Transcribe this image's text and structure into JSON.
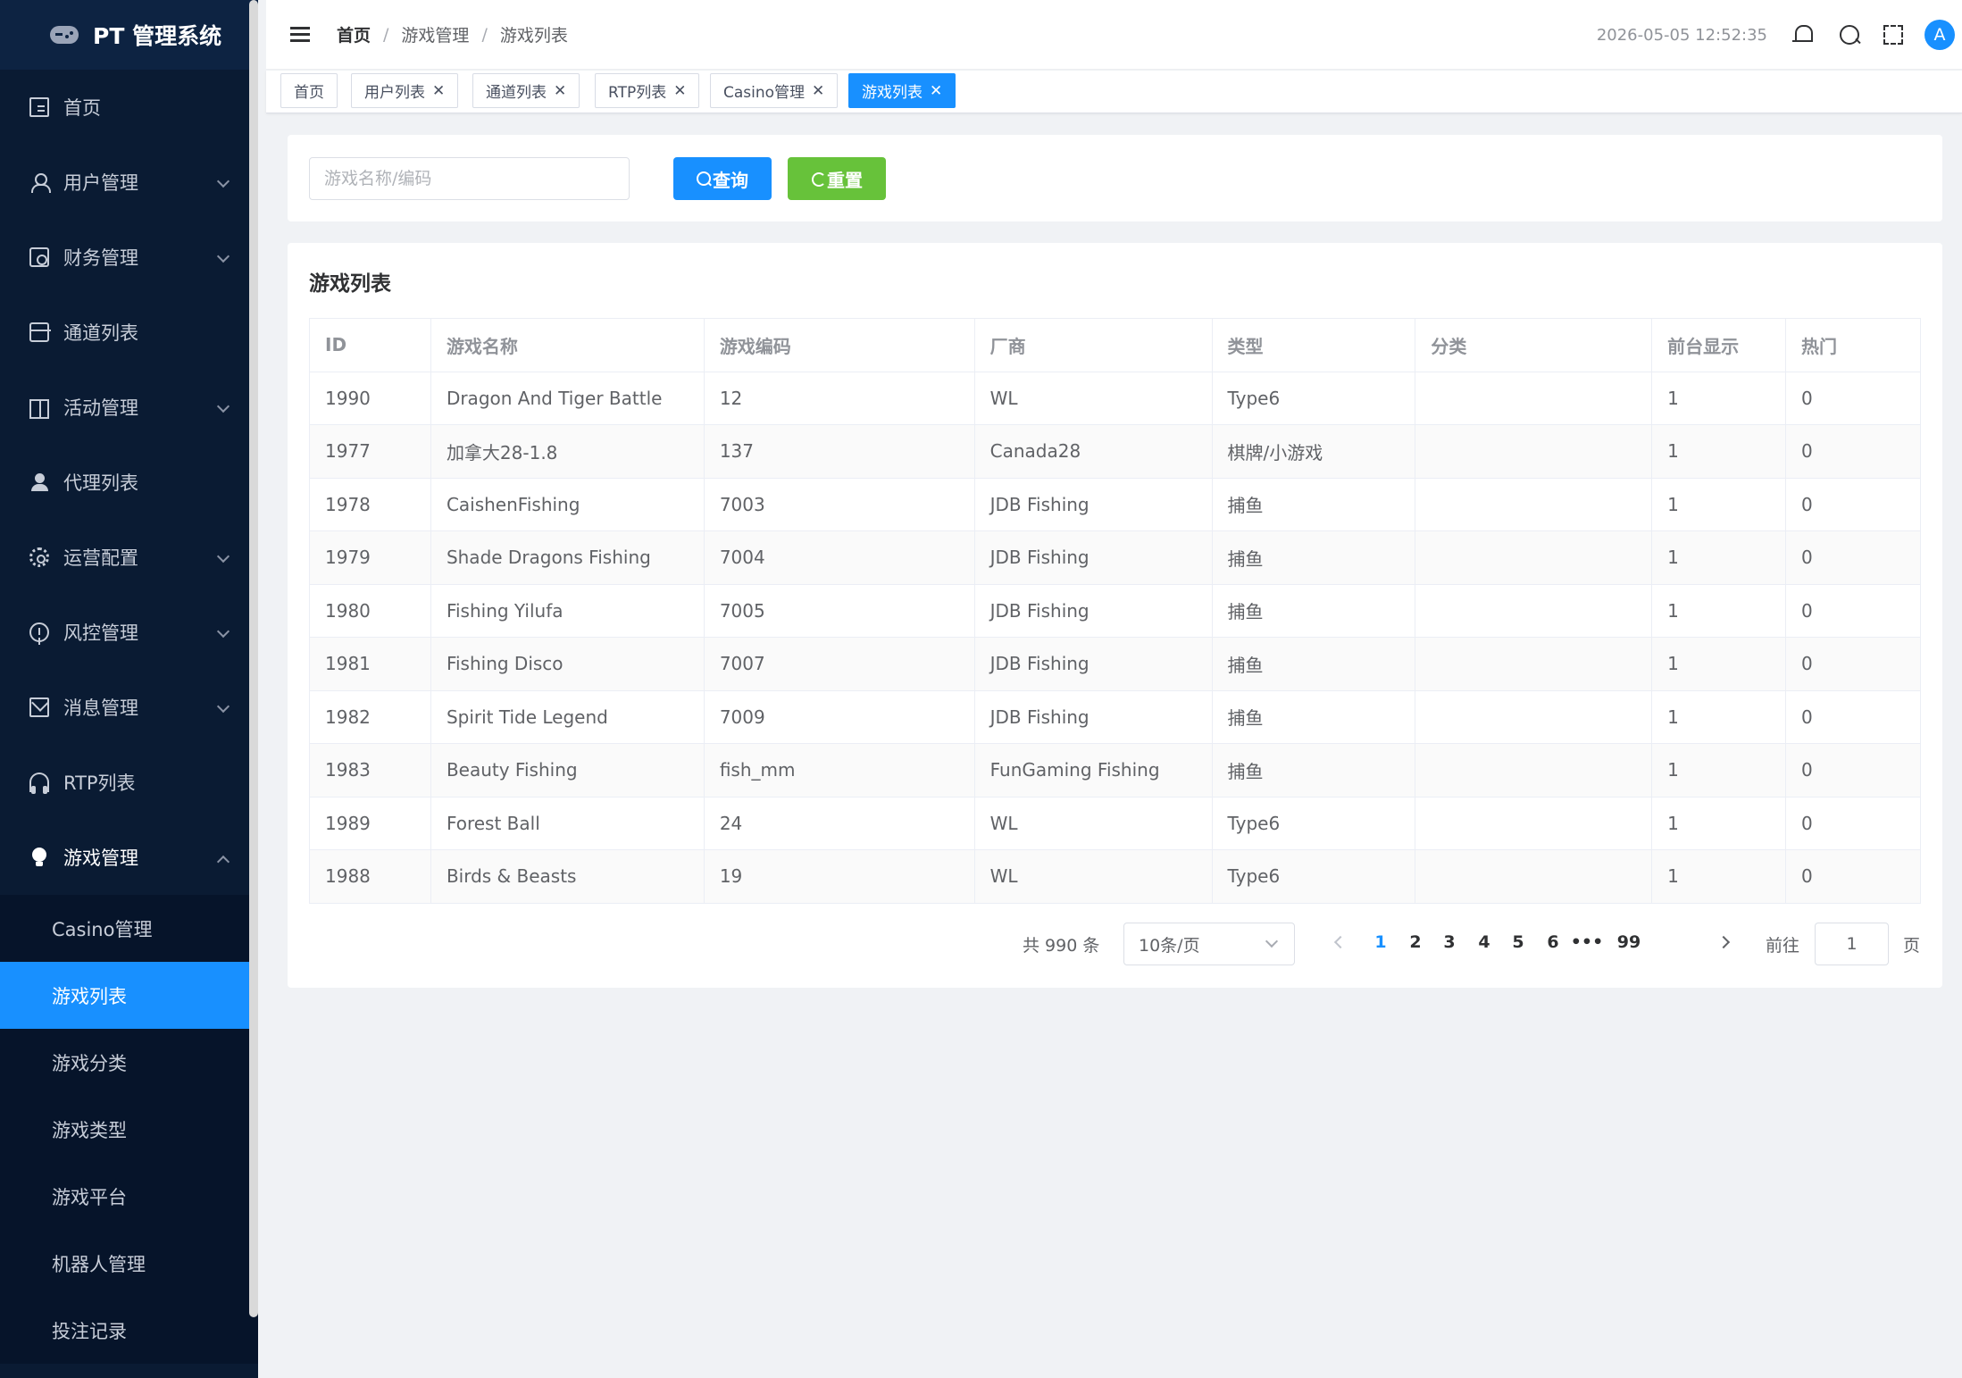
{
  "app": {
    "title": "PT 管理系统"
  },
  "sidebar": {
    "items": [
      {
        "label": "首页",
        "icon": "document-icon"
      },
      {
        "label": "用户管理",
        "icon": "user-icon"
      },
      {
        "label": "财务管理",
        "icon": "money-icon"
      },
      {
        "label": "通道列表",
        "icon": "card-icon"
      },
      {
        "label": "活动管理",
        "icon": "gift-icon"
      },
      {
        "label": "代理列表",
        "icon": "agent-icon"
      },
      {
        "label": "运营配置",
        "icon": "gear-icon"
      },
      {
        "label": "风控管理",
        "icon": "warning-icon"
      },
      {
        "label": "消息管理",
        "icon": "mail-icon"
      },
      {
        "label": "RTP列表",
        "icon": "headset-icon"
      },
      {
        "label": "游戏管理",
        "icon": "bulb-icon"
      }
    ],
    "submenu": [
      "Casino管理",
      "游戏列表",
      "游戏分类",
      "游戏类型",
      "游戏平台",
      "机器人管理",
      "投注记录"
    ]
  },
  "header": {
    "breadcrumb": [
      "首页",
      "游戏管理",
      "游戏列表"
    ],
    "separator": "/",
    "datetime": "2026-05-05 12:52:35",
    "avatar": "A"
  },
  "tags": [
    "首页",
    "用户列表",
    "通道列表",
    "RTP列表",
    "Casino管理",
    "游戏列表"
  ],
  "tag_close": "✕",
  "search": {
    "placeholder": "游戏名称/编码",
    "query_label": "查询",
    "reset_label": "重置"
  },
  "table": {
    "title": "游戏列表",
    "columns": [
      "ID",
      "游戏名称",
      "游戏编码",
      "厂商",
      "类型",
      "分类",
      "前台显示",
      "热门"
    ],
    "rows": [
      [
        "1990",
        "Dragon And Tiger Battle",
        "12",
        "WL",
        "Type6",
        "",
        "1",
        "0"
      ],
      [
        "1977",
        "加拿大28-1.8",
        "137",
        "Canada28",
        "棋牌/小游戏",
        "",
        "1",
        "0"
      ],
      [
        "1978",
        "CaishenFishing",
        "7003",
        "JDB Fishing",
        "捕鱼",
        "",
        "1",
        "0"
      ],
      [
        "1979",
        "Shade Dragons Fishing",
        "7004",
        "JDB Fishing",
        "捕鱼",
        "",
        "1",
        "0"
      ],
      [
        "1980",
        "Fishing Yilufa",
        "7005",
        "JDB Fishing",
        "捕鱼",
        "",
        "1",
        "0"
      ],
      [
        "1981",
        "Fishing Disco",
        "7007",
        "JDB Fishing",
        "捕鱼",
        "",
        "1",
        "0"
      ],
      [
        "1982",
        "Spirit Tide Legend",
        "7009",
        "JDB Fishing",
        "捕鱼",
        "",
        "1",
        "0"
      ],
      [
        "1983",
        "Beauty Fishing",
        "fish_mm",
        "FunGaming Fishing",
        "捕鱼",
        "",
        "1",
        "0"
      ],
      [
        "1989",
        "Forest Ball",
        "24",
        "WL",
        "Type6",
        "",
        "1",
        "0"
      ],
      [
        "1988",
        "Birds & Beasts",
        "19",
        "WL",
        "Type6",
        "",
        "1",
        "0"
      ]
    ]
  },
  "pagination": {
    "total": "共 990 条",
    "page_size": "10条/页",
    "pages": [
      "1",
      "2",
      "3",
      "4",
      "5",
      "6",
      "•••",
      "99"
    ],
    "current": "1",
    "goto_label": "前往",
    "goto_value": "1",
    "page_label": "页"
  }
}
